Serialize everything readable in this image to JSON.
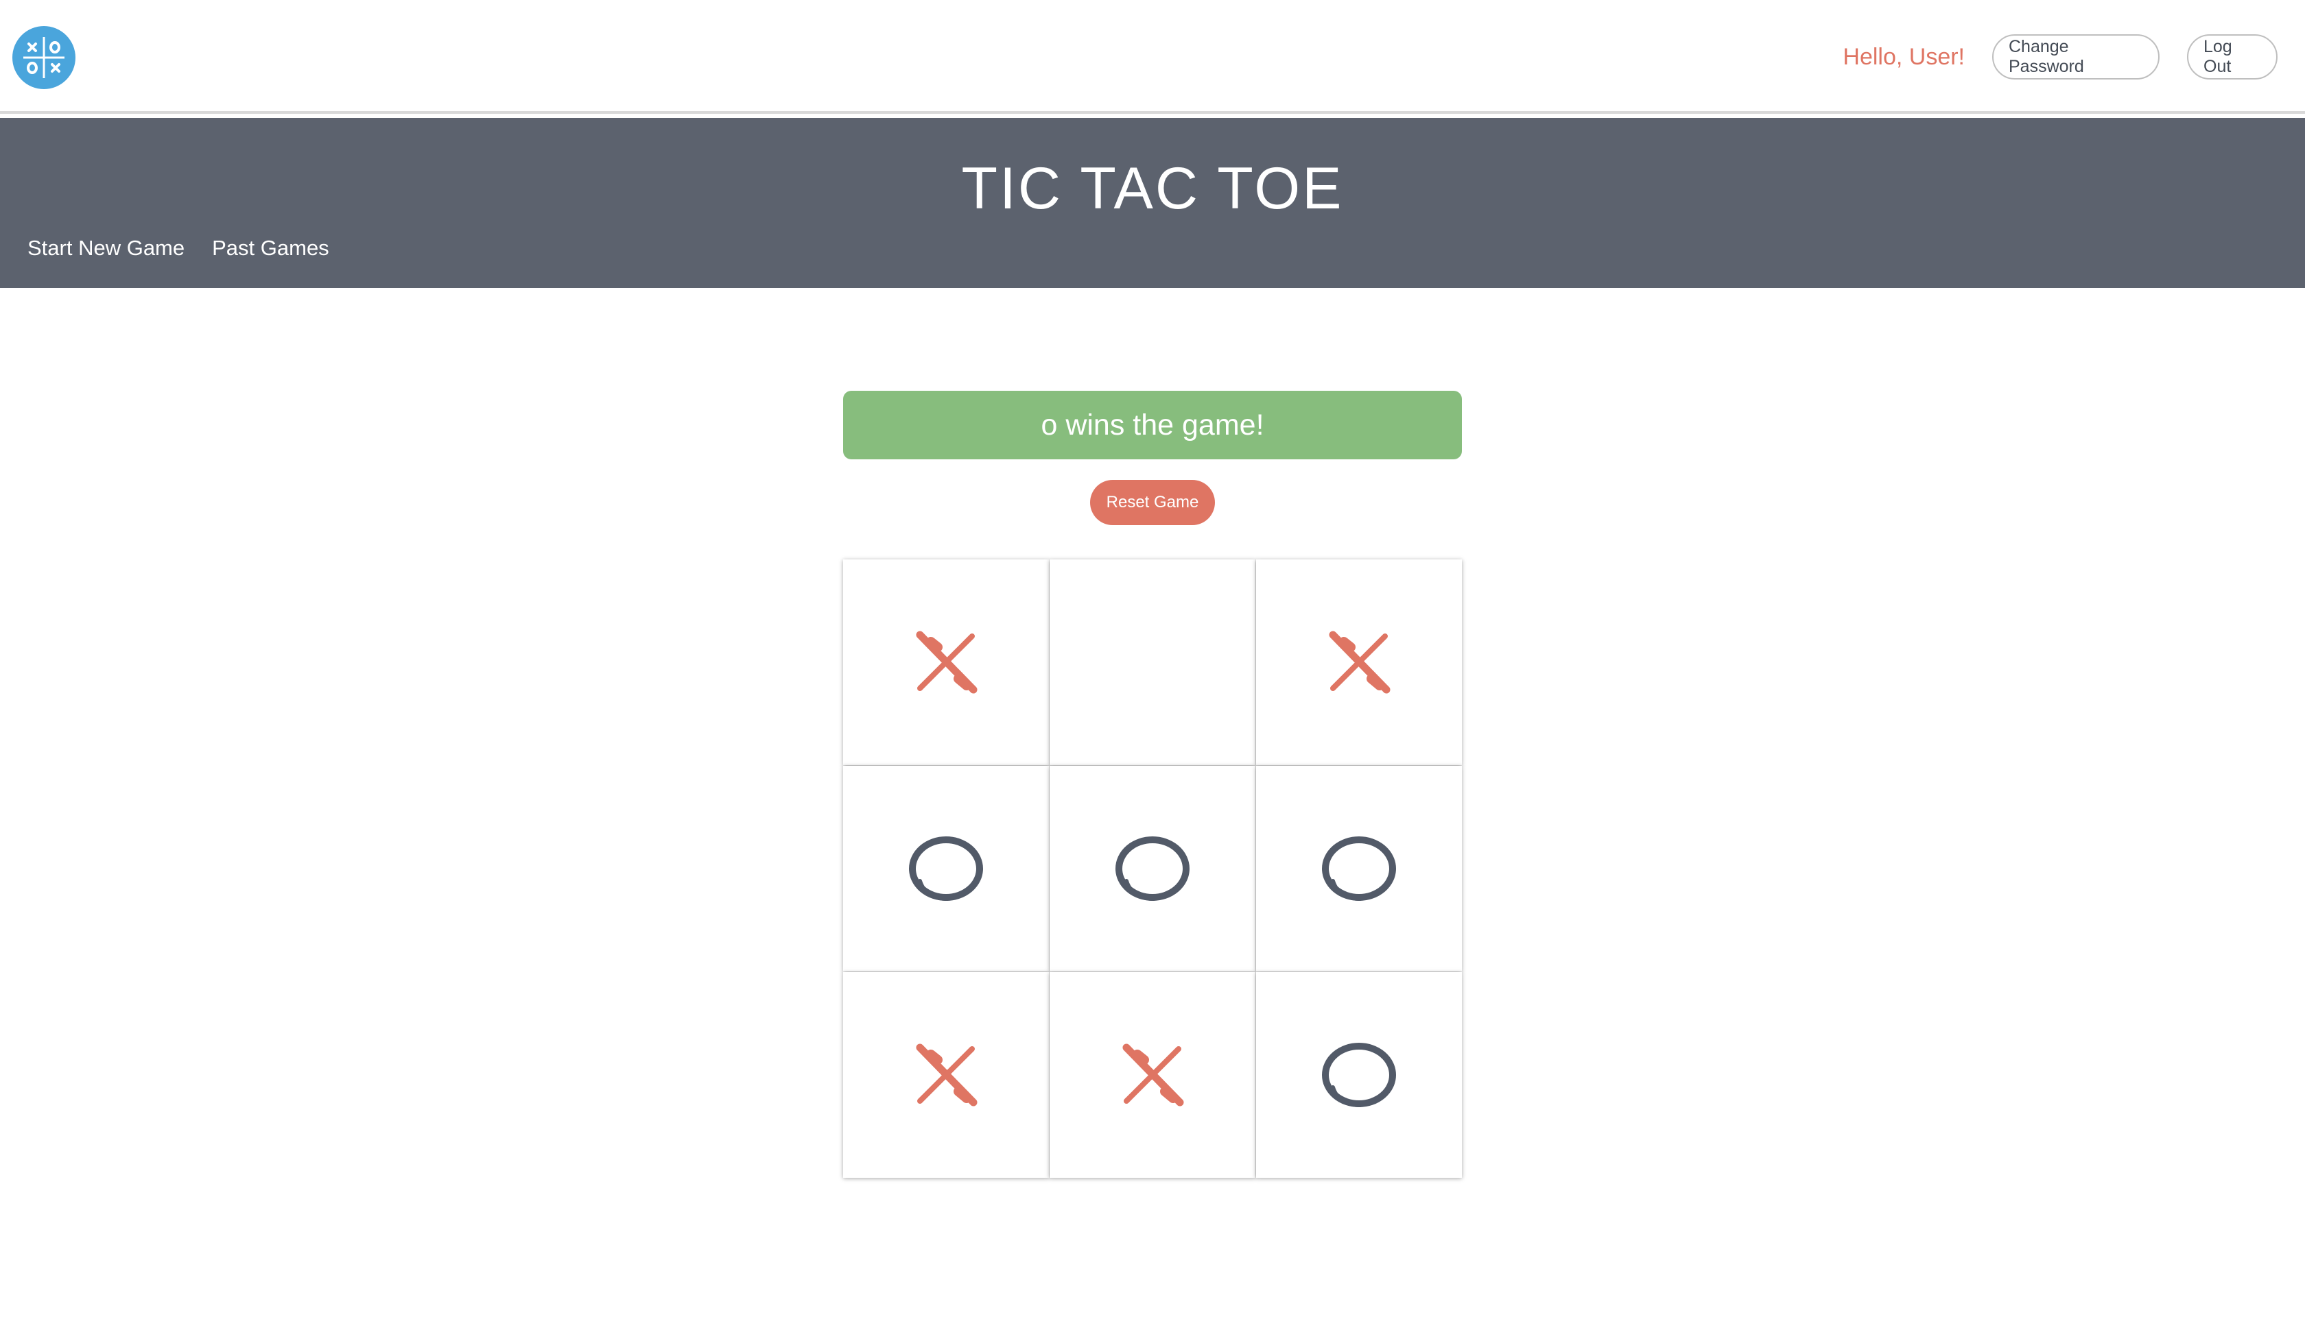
{
  "topbar": {
    "greeting": "Hello, User!",
    "change_password_label": "Change Password",
    "logout_label": "Log Out",
    "logo_icon": "tic-tac-toe-logo-icon"
  },
  "header": {
    "title": "TIC TAC TOE",
    "nav": [
      "Start New Game",
      "Past Games"
    ]
  },
  "game": {
    "status": "o wins the game!",
    "reset_label": "Reset Game",
    "board": [
      "x",
      "",
      "x",
      "o",
      "o",
      "o",
      "x",
      "x",
      "o"
    ]
  },
  "colors": {
    "accent": "#df7563",
    "header_band": "#5c626e",
    "win_banner": "#87bd7d",
    "logo": "#4aa5dc",
    "o_mark": "#525a68"
  }
}
